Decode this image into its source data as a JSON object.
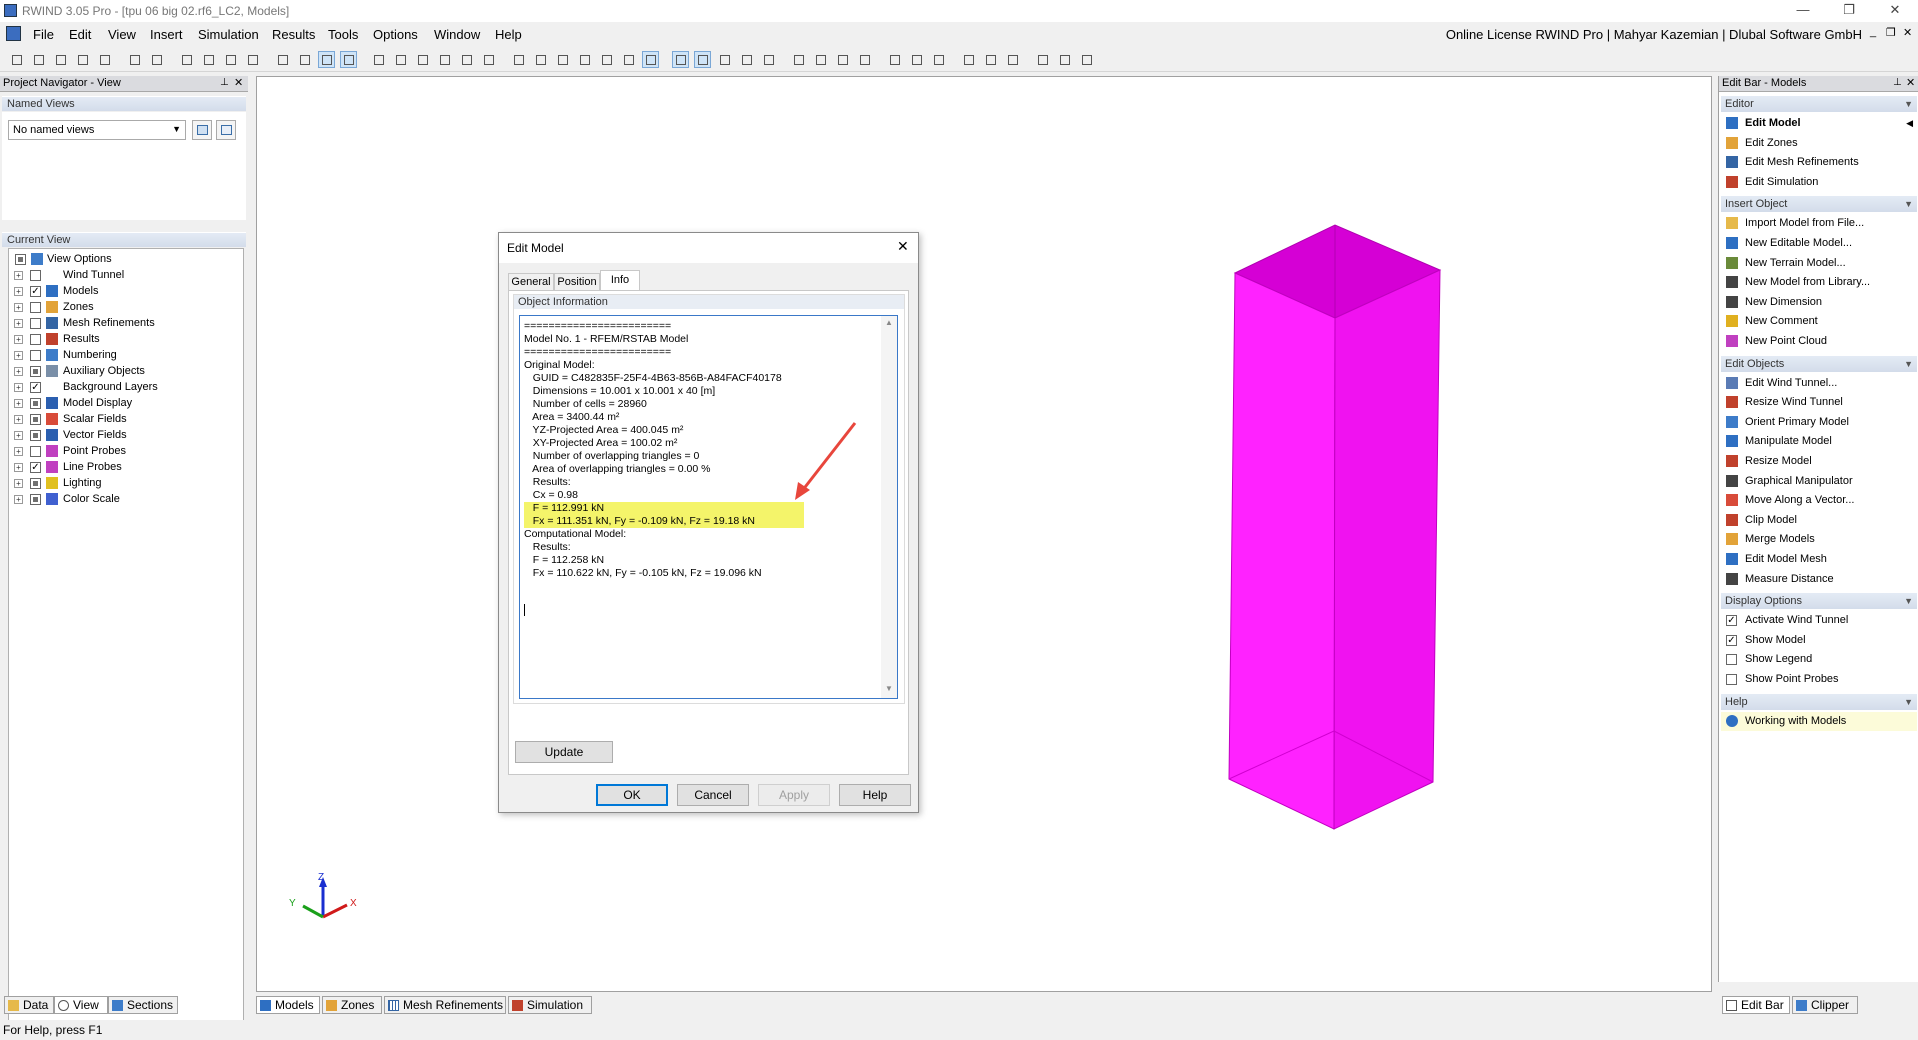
{
  "window": {
    "title": "RWIND 3.05 Pro - [tpu 06 big 02.rf6_LC2, Models]",
    "license": "Online License RWIND Pro | Mahyar Kazemian | Dlubal Software GmbH"
  },
  "menu": [
    "File",
    "Edit",
    "View",
    "Insert",
    "Simulation",
    "Results",
    "Tools",
    "Options",
    "Window",
    "Help"
  ],
  "navigator": {
    "title": "Project Navigator - View",
    "named_views_header": "Named Views",
    "named_views_value": "No named views",
    "current_view_header": "Current View",
    "tree": [
      {
        "label": "View Options",
        "icon": "view-options-icon",
        "check": "partial"
      },
      {
        "label": "Wind Tunnel",
        "icon": "",
        "check": "unchecked"
      },
      {
        "label": "Models",
        "icon": "models-icon",
        "check": "checked"
      },
      {
        "label": "Zones",
        "icon": "zones-icon",
        "check": "unchecked"
      },
      {
        "label": "Mesh Refinements",
        "icon": "mesh-icon",
        "check": "unchecked"
      },
      {
        "label": "Results",
        "icon": "results-icon",
        "check": "unchecked"
      },
      {
        "label": "Numbering",
        "icon": "numbering-icon",
        "check": "unchecked"
      },
      {
        "label": "Auxiliary Objects",
        "icon": "auxiliary-icon",
        "check": "partial"
      },
      {
        "label": "Background Layers",
        "icon": "",
        "check": "checked"
      },
      {
        "label": "Model Display",
        "icon": "model-display-icon",
        "check": "partial"
      },
      {
        "label": "Scalar Fields",
        "icon": "scalar-fields-icon",
        "check": "partial"
      },
      {
        "label": "Vector Fields",
        "icon": "vector-fields-icon",
        "check": "partial"
      },
      {
        "label": "Point Probes",
        "icon": "point-probes-icon",
        "check": "unchecked"
      },
      {
        "label": "Line Probes",
        "icon": "line-probes-icon",
        "check": "checked"
      },
      {
        "label": "Lighting",
        "icon": "lighting-icon",
        "check": "partial"
      },
      {
        "label": "Color Scale",
        "icon": "color-scale-icon",
        "check": "partial"
      }
    ],
    "tabs": [
      "Data",
      "View",
      "Sections"
    ]
  },
  "viewport_tabs": [
    "Models",
    "Zones",
    "Mesh Refinements",
    "Simulation"
  ],
  "axes": {
    "x": "X",
    "y": "Y",
    "z": "Z"
  },
  "colors": {
    "model": "#ff00ff",
    "highlight": "#f4f46a",
    "arrow": "#e8463c"
  },
  "dialog": {
    "title": "Edit Model",
    "tabs": [
      "General",
      "Position",
      "Info"
    ],
    "active_tab": "Info",
    "group_title": "Object Information",
    "info_lines": [
      "========================",
      "Model No. 1 - RFEM/RSTAB Model",
      "========================",
      "Original Model:",
      "   GUID = C482835F-25F4-4B63-856B-A84FACF40178",
      "   Dimensions = 10.001 x 10.001 x 40 [m]",
      "   Number of cells = 28960",
      "   Area = 3400.44 m²",
      "   YZ-Projected Area = 400.045 m²",
      "   XY-Projected Area = 100.02 m²",
      "   Number of overlapping triangles = 0",
      "   Area of overlapping triangles = 0.00 %",
      "   Results:",
      "   Cx = 0.98",
      "   F = 112.991 kN",
      "   Fx = 111.351 kN, Fy = -0.109 kN, Fz = 19.18 kN",
      "Computational Model:",
      "   Results:",
      "   F = 112.258 kN",
      "   Fx = 110.622 kN, Fy = -0.105 kN, Fz = 19.096 kN"
    ],
    "update_label": "Update",
    "ok_label": "OK",
    "cancel_label": "Cancel",
    "apply_label": "Apply",
    "help_label": "Help"
  },
  "editbar": {
    "title": "Edit Bar - Models",
    "sections": [
      {
        "title": "Editor",
        "items": [
          {
            "label": "Edit Model",
            "icon": "edit-model-icon",
            "bold": true
          },
          {
            "label": "Edit Zones",
            "icon": "edit-zones-icon"
          },
          {
            "label": "Edit Mesh Refinements",
            "icon": "edit-mesh-icon"
          },
          {
            "label": "Edit Simulation",
            "icon": "edit-simulation-icon"
          }
        ]
      },
      {
        "title": "Insert Object",
        "items": [
          {
            "label": "Import Model from File...",
            "icon": "folder-icon"
          },
          {
            "label": "New Editable Model...",
            "icon": "new-model-icon"
          },
          {
            "label": "New Terrain Model...",
            "icon": "terrain-icon"
          },
          {
            "label": "New Model from Library...",
            "icon": "library-icon"
          },
          {
            "label": "New Dimension",
            "icon": "dimension-icon"
          },
          {
            "label": "New Comment",
            "icon": "comment-icon"
          },
          {
            "label": "New Point Cloud",
            "icon": "point-cloud-icon"
          }
        ]
      },
      {
        "title": "Edit Objects",
        "items": [
          {
            "label": "Edit Wind Tunnel...",
            "icon": "wind-tunnel-icon"
          },
          {
            "label": "Resize Wind Tunnel",
            "icon": "resize-tunnel-icon"
          },
          {
            "label": "Orient Primary Model",
            "icon": "orient-icon"
          },
          {
            "label": "Manipulate Model",
            "icon": "manipulate-icon"
          },
          {
            "label": "Resize Model",
            "icon": "resize-model-icon"
          },
          {
            "label": "Graphical Manipulator",
            "icon": "manipulator-icon"
          },
          {
            "label": "Move Along a Vector...",
            "icon": "move-vector-icon"
          },
          {
            "label": "Clip Model",
            "icon": "clip-icon"
          },
          {
            "label": "Merge Models",
            "icon": "merge-icon"
          },
          {
            "label": "Edit Model Mesh",
            "icon": "model-mesh-icon"
          },
          {
            "label": "Measure Distance",
            "icon": "measure-icon"
          }
        ]
      },
      {
        "title": "Display Options",
        "items": [
          {
            "label": "Activate Wind Tunnel",
            "check": true
          },
          {
            "label": "Show Model",
            "check": true
          },
          {
            "label": "Show Legend",
            "check": false
          },
          {
            "label": "Show Point Probes",
            "check": false
          }
        ]
      },
      {
        "title": "Help",
        "items": [
          {
            "label": "Working with Models",
            "icon": "help-icon"
          }
        ]
      }
    ],
    "tabs": [
      "Edit Bar",
      "Clipper"
    ]
  },
  "status": "For Help, press F1"
}
